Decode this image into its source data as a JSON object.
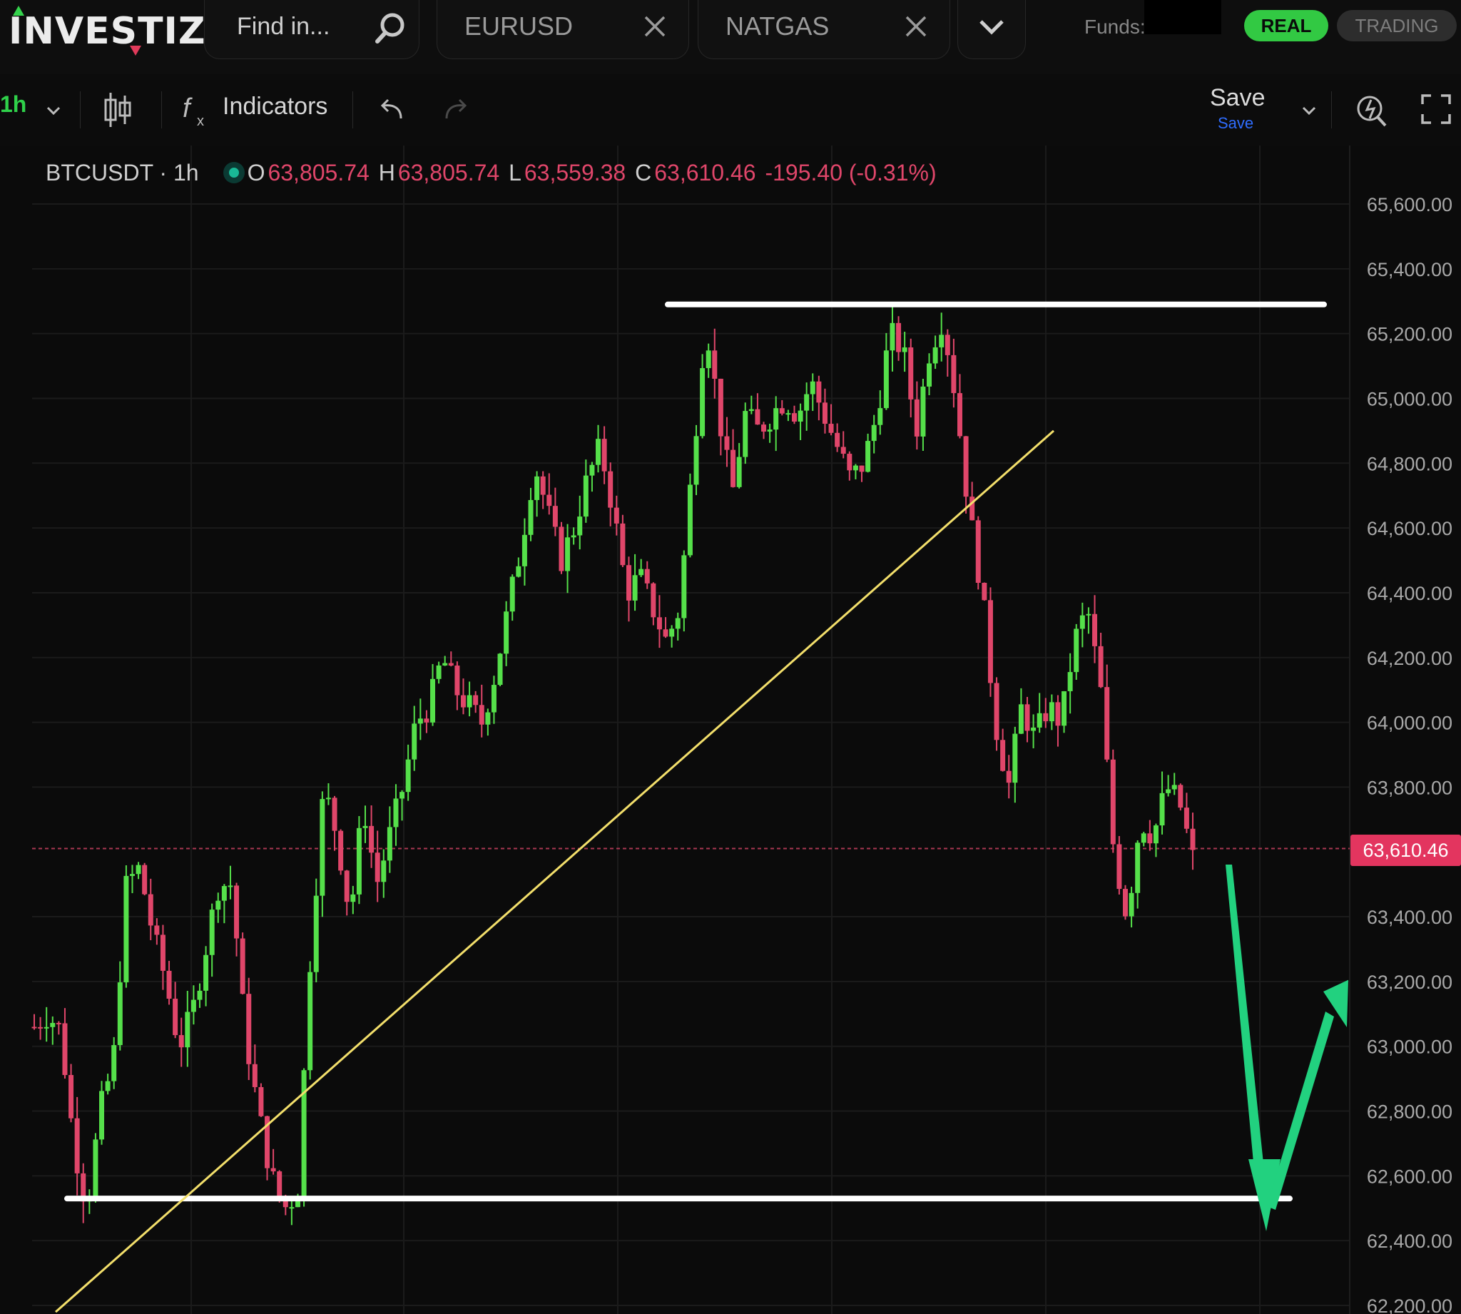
{
  "header": {
    "logo": "INVESTIZO",
    "search_placeholder": "Find in...",
    "tabs": [
      {
        "label": "EURUSD"
      },
      {
        "label": "NATGAS"
      }
    ],
    "funds_label": "Funds:",
    "mode_real": "REAL",
    "mode_trading": "TRADING"
  },
  "toolbar": {
    "timeframe": "1h",
    "indicators_label": "Indicators",
    "save_label": "Save",
    "save_sublabel": "Save"
  },
  "legend": {
    "symbol": "BTCUSDT · 1h",
    "open_label": "O",
    "open": "63,805.74",
    "high_label": "H",
    "high": "63,805.74",
    "low_label": "L",
    "low": "63,559.38",
    "close_label": "C",
    "close": "63,610.46",
    "change": "-195.40 (-0.31%)"
  },
  "chart_data": {
    "type": "candlestick",
    "symbol": "BTCUSDT",
    "interval": "1h",
    "last_price": 63610.46,
    "last_price_label": "63,610.46",
    "ylim": [
      62200,
      65750
    ],
    "y_ticks": [
      65600,
      65400,
      65200,
      65000,
      64800,
      64600,
      64400,
      64200,
      64000,
      63800,
      63400,
      63200,
      63000,
      62800,
      62600,
      62400,
      62200
    ],
    "y_tick_labels": [
      "65,600.00",
      "65,400.00",
      "65,200.00",
      "65,000.00",
      "64,800.00",
      "64,600.00",
      "64,400.00",
      "64,200.00",
      "64,000.00",
      "63,800.00",
      "63,400.00",
      "63,200.00",
      "63,000.00",
      "62,800.00",
      "62,600.00",
      "62,400.00",
      "62,200.00"
    ],
    "close_path": [
      63060,
      63100,
      63050,
      62700,
      62500,
      62800,
      62950,
      63500,
      63550,
      63350,
      63200,
      63000,
      63100,
      63300,
      63500,
      63500,
      63050,
      62800,
      62600,
      62500,
      62550,
      63300,
      63800,
      63650,
      63400,
      63750,
      63500,
      63650,
      63800,
      64000,
      64050,
      64200,
      64100,
      64050,
      64000,
      64150,
      64350,
      64550,
      64800,
      64650,
      64500,
      64600,
      64750,
      64850,
      64650,
      64400,
      64450,
      64350,
      64250,
      64350,
      64800,
      65250,
      64950,
      64700,
      64950,
      64900,
      64950,
      65000,
      64950,
      65050,
      64950,
      64850,
      64750,
      64800,
      64950,
      65200,
      65150,
      64900,
      65150,
      65250,
      65000,
      64650,
      64400,
      64000,
      63800,
      64050,
      63950,
      64050,
      64000,
      64250,
      64350,
      64100,
      63600,
      63400,
      63700,
      63650,
      63800,
      63750,
      63580
    ],
    "drawings": {
      "resistance_line_price": 65290,
      "support_line_price": 62530,
      "trendline": {
        "from_price": 62180,
        "to_price": 64900
      },
      "arrow": {
        "dip_to_price": 62550,
        "rebound_to_price": 63150
      }
    },
    "colors": {
      "up": "#55e04a",
      "down": "#e0466a",
      "resistance": "#ffffff",
      "support": "#ffffff",
      "trendline": "#f3df6b",
      "arrow": "#22d17f",
      "last_price_line": "#e0466a"
    }
  }
}
